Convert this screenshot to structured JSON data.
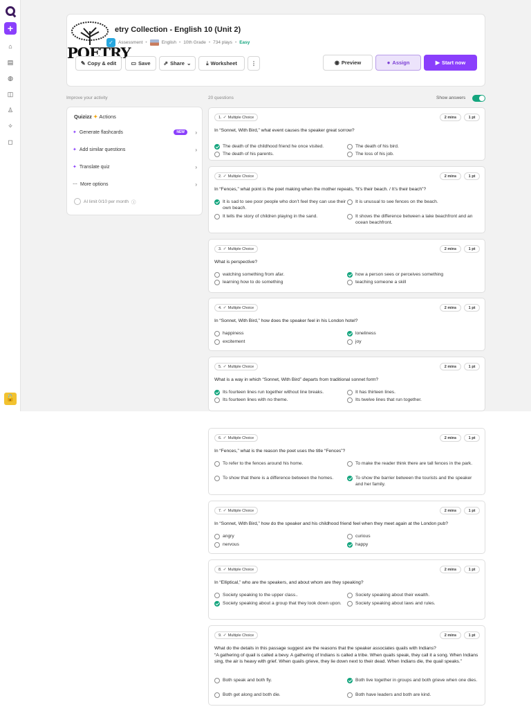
{
  "header": {
    "title": "etry Collection - English 10 (Unit 2)",
    "thumb_word": "POETRY",
    "type": "Assessment",
    "subject": "English",
    "grade": "10th Grade",
    "plays": "734 plays",
    "difficulty": "Easy",
    "buttons": {
      "copy_edit": "Copy & edit",
      "save": "Save",
      "share": "Share",
      "worksheet": "Worksheet",
      "more": "⋮",
      "preview": "Preview",
      "assign": "Assign",
      "start": "Start now"
    }
  },
  "improve": {
    "label": "Improve your activity",
    "brand": "Quizizz",
    "actions_label": "Actions",
    "items": [
      {
        "label": "Generate flashcards",
        "badge": "NEW"
      },
      {
        "label": "Add similar questions"
      },
      {
        "label": "Translate quiz"
      },
      {
        "label": "More options"
      }
    ],
    "limit": "AI limit 0/10 per month"
  },
  "questions_header": {
    "count": "20 questions",
    "show_answers": "Show answers",
    "show_answers_on": true
  },
  "question_meta": {
    "type": "Multiple Choice",
    "time": "2 mins",
    "points": "1 pt"
  },
  "questions": [
    {
      "num": "1.",
      "text": "In “Sonnet, With Bird,” what event causes the speaker great sorrow?",
      "options": [
        {
          "text": "The death of the childhood friend he once visited.",
          "correct": true
        },
        {
          "text": "The death of his bird.",
          "correct": false
        },
        {
          "text": "The death of his parents.",
          "correct": false
        },
        {
          "text": "The loss of his job.",
          "correct": false
        }
      ]
    },
    {
      "num": "2.",
      "text": "In “Fences,” what point is the poet making when the mother repeats, “It’s their beach. / It’s their beach”?",
      "options": [
        {
          "text": "It is sad to see poor people who don’t feel they can use their own beach.",
          "correct": true
        },
        {
          "text": "It is unusual to see fences on the beach.",
          "correct": false
        },
        {
          "text": "It tells the story of children playing in the sand.",
          "correct": false
        },
        {
          "text": "It shows the difference between a lake beachfront and an ocean beachfront.",
          "correct": false
        }
      ]
    },
    {
      "num": "3.",
      "text": "What is perspective?",
      "options": [
        {
          "text": "watching something from afar.",
          "correct": false
        },
        {
          "text": "how a person sees or perceives something",
          "correct": true
        },
        {
          "text": "learning how to do something",
          "correct": false
        },
        {
          "text": "teaching someone a skill",
          "correct": false
        }
      ]
    },
    {
      "num": "4.",
      "text": "In “Sonnet, With Bird,” how does the speaker feel in his London hotel?",
      "options": [
        {
          "text": "happiness",
          "correct": false
        },
        {
          "text": "loneliness",
          "correct": true
        },
        {
          "text": "excitement",
          "correct": false
        },
        {
          "text": "joy",
          "correct": false
        }
      ]
    },
    {
      "num": "5.",
      "text": "What is a way in which “Sonnet, With Bird” departs from traditional sonnet form?",
      "options": [
        {
          "text": "Its fourteen lines run together without line breaks.",
          "correct": true
        },
        {
          "text": "It has thirteen lines.",
          "correct": false
        },
        {
          "text": "Its fourteen lines with no theme.",
          "correct": false
        },
        {
          "text": "Its twelve lines that run together.",
          "correct": false
        }
      ]
    },
    {
      "num": "6.",
      "text": "In “Fences,” what is the reason the poet uses the title “Fences”?",
      "options": [
        {
          "text": "To refer to the fences around his home.",
          "correct": false
        },
        {
          "text": "To make the reader think there are tall fences in the park.",
          "correct": false
        },
        {
          "text": "To show that there is a difference between the homes.",
          "correct": false
        },
        {
          "text": "To show the barrier between the tourists and the speaker and her family.",
          "correct": true
        }
      ]
    },
    {
      "num": "7.",
      "text": "In “Sonnet, With Bird,” how do the speaker and his childhood friend feel when they meet again at the London pub?",
      "options": [
        {
          "text": "angry",
          "correct": false
        },
        {
          "text": "curious",
          "correct": false
        },
        {
          "text": "nervous",
          "correct": false
        },
        {
          "text": "happy",
          "correct": true
        }
      ]
    },
    {
      "num": "8.",
      "text": "In “Elliptical,” who are the speakers, and about whom are they speaking?",
      "options": [
        {
          "text": "Society speaking to the upper class..",
          "correct": false
        },
        {
          "text": "Society speaking about their wealth.",
          "correct": false
        },
        {
          "text": "Society speaking about a group that they look down upon.",
          "correct": true
        },
        {
          "text": "Society speaking about laws and rules.",
          "correct": false
        }
      ]
    },
    {
      "num": "9.",
      "text": "What do the details in this passage suggest are the reasons that the speaker associates quails with Indians?",
      "passage": "“A gathering of quail is called a bevy. A gathering of Indians is called a tribe. When quails speak, they call it a song. When Indians sing, the air is heavy with grief. When quails grieve, they lie down next to their dead. When Indians die, the quail speaks.”",
      "options": [
        {
          "text": "Both speak and both fly.",
          "correct": false
        },
        {
          "text": "Both live together in groups and both grieve when one dies.",
          "correct": true
        },
        {
          "text": "Both get along and both die.",
          "correct": false
        },
        {
          "text": "Both have leaders and both are kind.",
          "correct": false
        }
      ]
    }
  ]
}
